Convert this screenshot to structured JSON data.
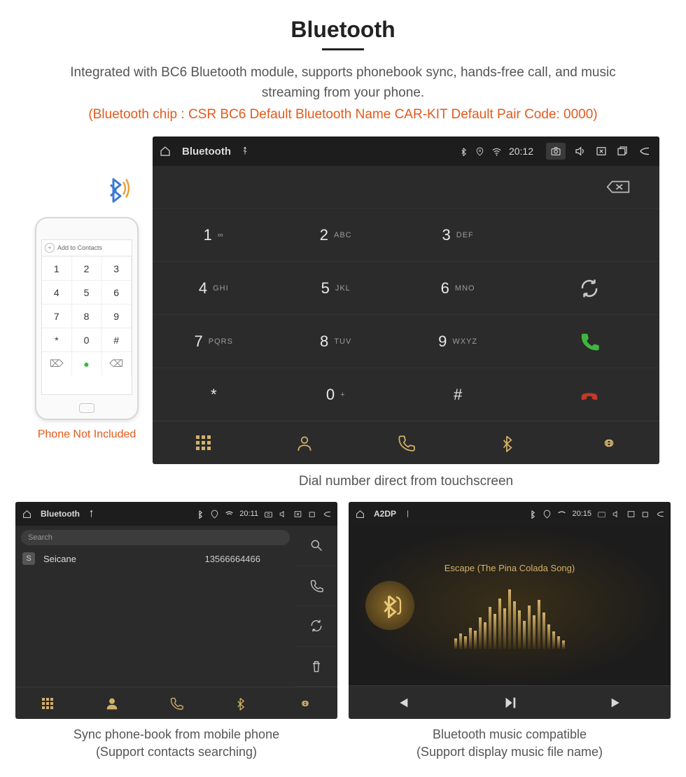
{
  "title": "Bluetooth",
  "description": "Integrated with BC6 Bluetooth module, supports phonebook sync, hands-free call, and music streaming from your phone.",
  "specs": "(Bluetooth chip : CSR BC6     Default Bluetooth Name CAR-KIT     Default Pair Code: 0000)",
  "dialer": {
    "app_label": "Bluetooth",
    "time": "20:12",
    "keys": [
      {
        "d": "1",
        "s": "∞"
      },
      {
        "d": "2",
        "s": "ABC"
      },
      {
        "d": "3",
        "s": "DEF"
      },
      {
        "d": "4",
        "s": "GHI"
      },
      {
        "d": "5",
        "s": "JKL"
      },
      {
        "d": "6",
        "s": "MNO"
      },
      {
        "d": "7",
        "s": "PQRS"
      },
      {
        "d": "8",
        "s": "TUV"
      },
      {
        "d": "9",
        "s": "WXYZ"
      },
      {
        "d": "*",
        "s": ""
      },
      {
        "d": "0",
        "s": "+"
      },
      {
        "d": "#",
        "s": ""
      }
    ],
    "caption": "Dial number direct from touchscreen"
  },
  "phone": {
    "add_contacts": "Add to Contacts",
    "caption": "Phone Not Included"
  },
  "phonebook": {
    "app_label": "Bluetooth",
    "time": "20:11",
    "search_placeholder": "Search",
    "contact_name": "Seicane",
    "contact_number": "13566664466",
    "caption_l1": "Sync phone-book from mobile phone",
    "caption_l2": "(Support contacts searching)"
  },
  "music": {
    "app_label": "A2DP",
    "time": "20:15",
    "track": "Escape (The Pina Colada Song)",
    "viz": [
      15,
      22,
      18,
      30,
      26,
      45,
      38,
      60,
      50,
      72,
      58,
      85,
      68,
      55,
      40,
      62,
      48,
      70,
      52,
      35,
      25,
      18,
      12
    ],
    "caption_l1": "Bluetooth music compatible",
    "caption_l2": "(Support display music file name)"
  }
}
